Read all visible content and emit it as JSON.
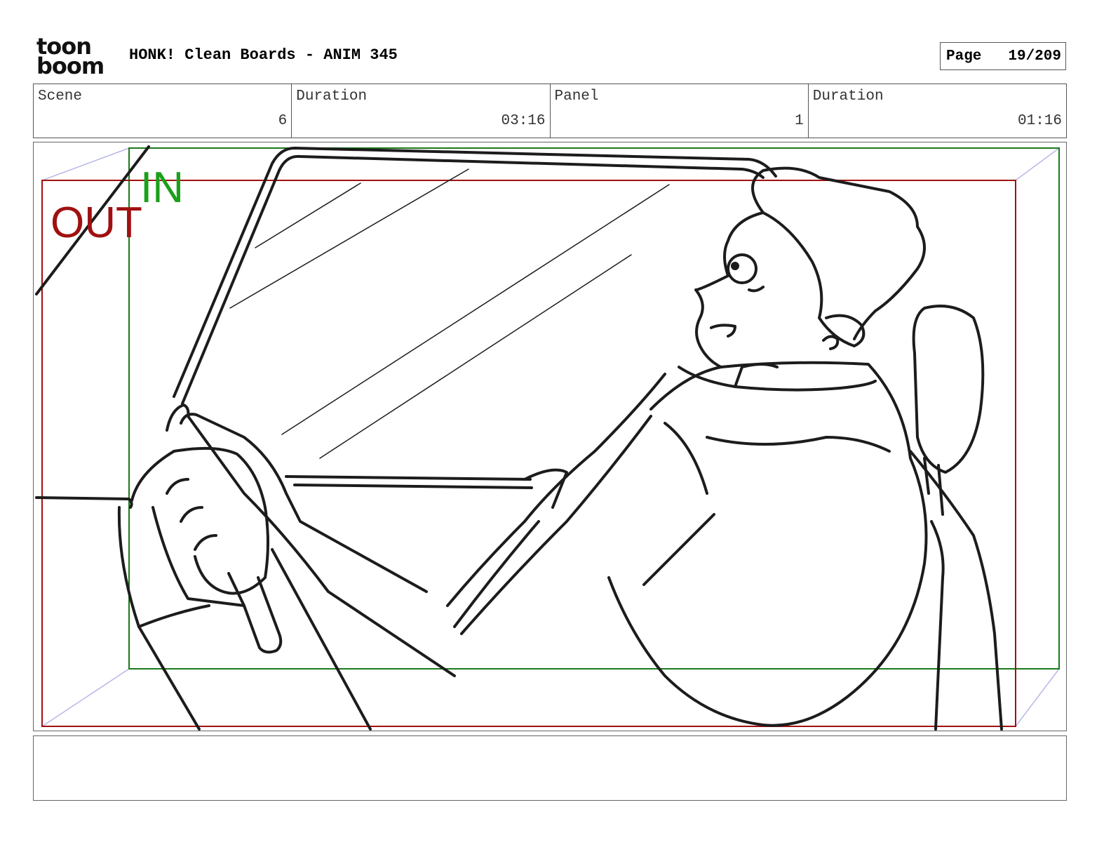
{
  "header": {
    "logo": {
      "line1": "toon",
      "line2": "boom",
      "icon": "toon-boom-logo-icon"
    },
    "title": "HONK! Clean Boards - ANIM 345",
    "page_label": "Page",
    "page_value": "19/209"
  },
  "info": {
    "scene_label": "Scene",
    "scene_value": "6",
    "duration1_label": "Duration",
    "duration1_value": "03:16",
    "panel_label": "Panel",
    "panel_value": "1",
    "duration2_label": "Duration",
    "duration2_value": "01:16"
  },
  "frame": {
    "in_label": "IN",
    "out_label": "OUT",
    "colors": {
      "in": "#1aa01a",
      "out": "#a01010",
      "camera_path": "#b8b8e8"
    },
    "drawing": "line-art-driver-in-car-icon"
  },
  "notes": {
    "text": ""
  }
}
